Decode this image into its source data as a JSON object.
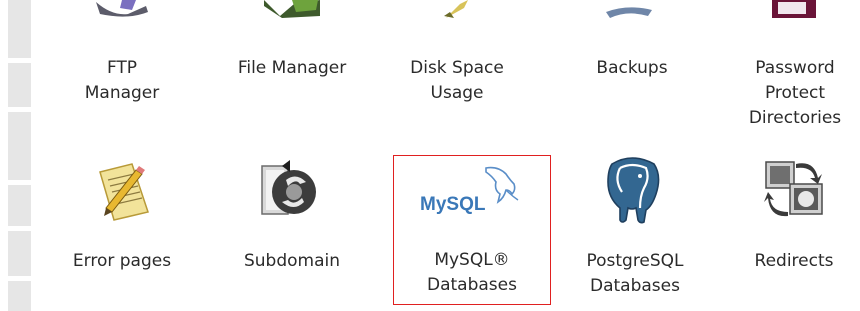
{
  "icons_row1": [
    {
      "name": "ftp-manager",
      "label": "FTP\nManager",
      "icon": "ftp-icon"
    },
    {
      "name": "file-manager",
      "label": "File Manager",
      "icon": "file-manager-icon"
    },
    {
      "name": "disk-space-usage",
      "label": "Disk Space\nUsage",
      "icon": "disk-space-icon"
    },
    {
      "name": "backups",
      "label": "Backups",
      "icon": "backups-icon"
    },
    {
      "name": "password-protect-directories",
      "label": "Password\nProtect\nDirectories",
      "icon": "password-protect-icon"
    }
  ],
  "icons_row2": [
    {
      "name": "error-pages",
      "label": "Error pages",
      "icon": "error-pages-icon"
    },
    {
      "name": "subdomain",
      "label": "Subdomain",
      "icon": "subdomain-icon"
    },
    {
      "name": "mysql-databases",
      "label": "MySQL®\nDatabases",
      "icon": "mysql-icon",
      "logo_text": "MySQL",
      "highlighted": true
    },
    {
      "name": "postgresql-databases",
      "label": "PostgreSQL\nDatabases",
      "icon": "postgresql-elephant-icon"
    },
    {
      "name": "redirects",
      "label": "Redirects",
      "icon": "redirects-icon"
    }
  ],
  "colors": {
    "highlight_border": "#e02020",
    "label_text": "#2b2b2b",
    "left_strip": "#e6e6e6",
    "mysql_blue": "#3a78b8",
    "mysql_orange": "#e8901c",
    "postgres_blue": "#336791"
  }
}
